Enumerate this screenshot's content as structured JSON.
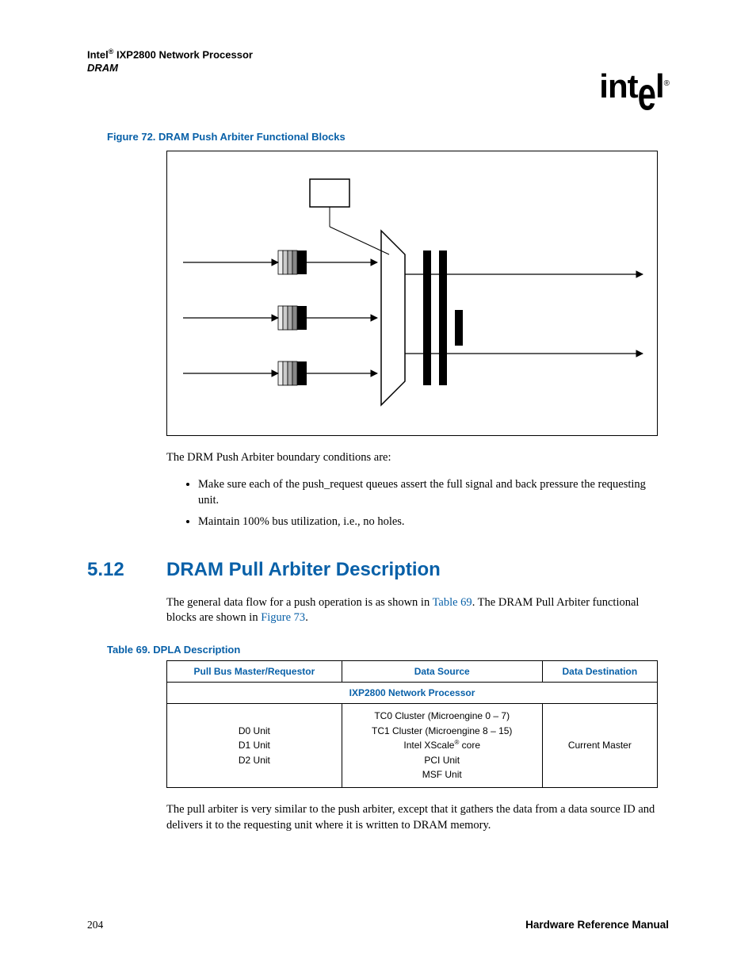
{
  "header": {
    "brand_prefix": "Intel",
    "reg_mark": "®",
    "product": " IXP2800 Network Processor",
    "subsection": "DRAM"
  },
  "logo": {
    "text_pre": "int",
    "text_drop": "e",
    "text_post": "l",
    "reg": "®"
  },
  "figure": {
    "caption": "Figure 72. DRAM Push Arbiter Functional Blocks"
  },
  "paragraph_after_figure": "The DRM Push Arbiter boundary conditions are:",
  "bullets": [
    "Make sure each of the push_request queues assert the full signal and back pressure the requesting unit.",
    "Maintain 100% bus utilization, i.e., no holes."
  ],
  "section": {
    "number": "5.12",
    "title": "DRAM Pull Arbiter Description"
  },
  "intro_paragraph": {
    "pre": "The general data flow for a push operation is as shown in ",
    "link1": "Table 69",
    "mid": ". The DRAM Pull Arbiter functional blocks are shown in ",
    "link2": "Figure 73",
    "post": "."
  },
  "table": {
    "caption": "Table 69.  DPLA Description",
    "headers": [
      "Pull Bus Master/Requestor",
      "Data Source",
      "Data Destination"
    ],
    "span_row": "IXP2800 Network Processor",
    "row": {
      "col1_lines": [
        "D0 Unit",
        "D1 Unit",
        "D2 Unit"
      ],
      "col2_lines_pre": [
        "TC0 Cluster (Microengine 0 – 7)",
        "TC1 Cluster (Microengine 8 – 15)"
      ],
      "col2_line_xscale_pre": "Intel XScale",
      "col2_line_xscale_sup": "®",
      "col2_line_xscale_post": " core",
      "col2_lines_post": [
        "PCI Unit",
        "MSF Unit"
      ],
      "col3": "Current Master"
    }
  },
  "closing_paragraph": "The pull arbiter is very similar to the push arbiter, except that it gathers the data from a data source ID and delivers it to the requesting unit where it is written to DRAM memory.",
  "footer": {
    "page": "204",
    "manual": "Hardware Reference Manual"
  }
}
